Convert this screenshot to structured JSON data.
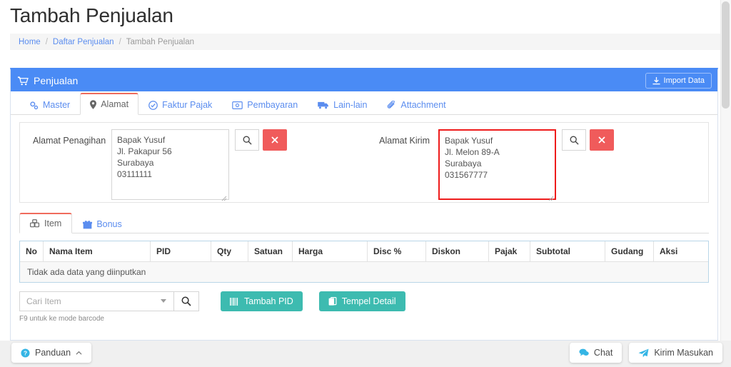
{
  "page": {
    "title": "Tambah Penjualan"
  },
  "breadcrumb": {
    "home": "Home",
    "level2": "Daftar Penjualan",
    "current": "Tambah Penjualan",
    "separator": "/"
  },
  "panel": {
    "title": "Penjualan",
    "title_icon": "shopping-cart-icon",
    "import_button": "Import Data",
    "import_icon": "download-icon",
    "accent_color": "#4a8bf5"
  },
  "main_tabs": [
    {
      "label": "Master",
      "icon": "gears-icon",
      "active": false
    },
    {
      "label": "Alamat",
      "icon": "map-marker-icon",
      "active": true
    },
    {
      "label": "Faktur Pajak",
      "icon": "check-circle-icon",
      "active": false
    },
    {
      "label": "Pembayaran",
      "icon": "money-icon",
      "active": false
    },
    {
      "label": "Lain-lain",
      "icon": "truck-icon",
      "active": false
    },
    {
      "label": "Attachment",
      "icon": "paperclip-icon",
      "active": false
    }
  ],
  "address": {
    "billing": {
      "label": "Alamat Penagihan",
      "value": "Bapak Yusuf\nJl. Pakapur 56\nSurabaya\n03111111",
      "highlighted": false,
      "search_icon": "search-icon",
      "clear_icon": "times-icon"
    },
    "shipping": {
      "label": "Alamat Kirim",
      "value": "Bapak Yusuf\nJl. Melon 89-A\nSurabaya\n031567777",
      "highlighted": true,
      "highlight_color": "#ee1c1c",
      "search_icon": "search-icon",
      "clear_icon": "times-icon"
    }
  },
  "item_tabs": [
    {
      "label": "Item",
      "icon": "cubes-icon",
      "active": true
    },
    {
      "label": "Bonus",
      "icon": "gift-icon",
      "active": false
    }
  ],
  "table": {
    "columns": [
      "No",
      "Nama Item",
      "PID",
      "Qty",
      "Satuan",
      "Harga",
      "Disc %",
      "Diskon",
      "Pajak",
      "Subtotal",
      "Gudang",
      "Aksi"
    ],
    "rows": [],
    "empty_message": "Tidak ada data yang diinputkan"
  },
  "controls": {
    "search_placeholder": "Cari Item",
    "search_value": "",
    "search_icon": "search-icon",
    "caret_icon": "caret-down-icon",
    "hint": "F9 untuk ke mode barcode",
    "add_pid_button": "Tambah PID",
    "add_pid_icon": "barcode-icon",
    "paste_detail_button": "Tempel Detail",
    "paste_detail_icon": "clipboard-icon",
    "button_color": "#3dbbb0"
  },
  "footer": {
    "guide_button": "Panduan",
    "guide_icon": "question-circle-icon",
    "guide_caret": "chevron-up-icon",
    "chat_button": "Chat",
    "chat_icon": "comments-icon",
    "feedback_button": "Kirim Masukan",
    "feedback_icon": "paper-plane-icon"
  }
}
